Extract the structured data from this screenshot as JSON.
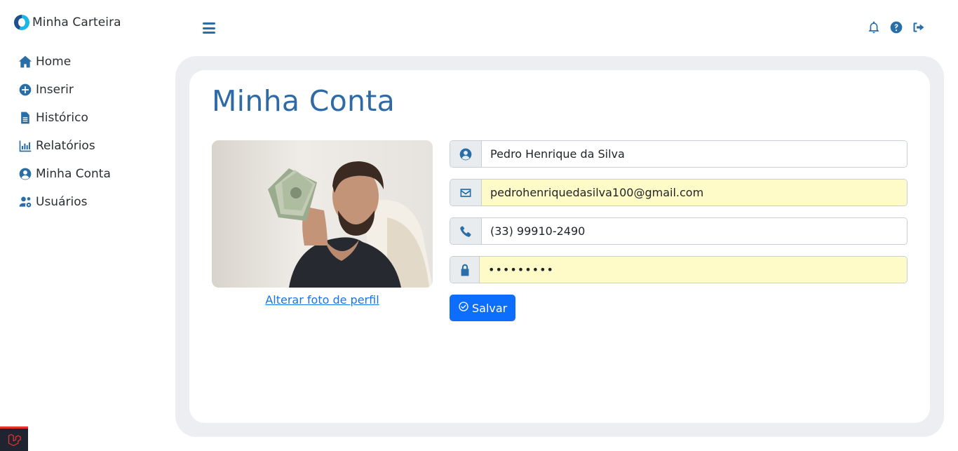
{
  "brand": {
    "name": "Minha Carteira"
  },
  "sidebar": {
    "items": [
      {
        "label": "Home",
        "icon": "home-icon"
      },
      {
        "label": "Inserir",
        "icon": "plus-circle-icon"
      },
      {
        "label": "Histórico",
        "icon": "file-icon"
      },
      {
        "label": "Relatórios",
        "icon": "bar-chart-icon"
      },
      {
        "label": "Minha Conta",
        "icon": "user-circle-icon"
      },
      {
        "label": "Usuários",
        "icon": "users-cog-icon"
      }
    ]
  },
  "topbar": {
    "menu_icon": "hamburger-icon",
    "icons": [
      "bell-icon",
      "help-icon",
      "logout-icon"
    ]
  },
  "page": {
    "title": "Minha Conta",
    "change_photo_label": "Alterar foto de perfil"
  },
  "form": {
    "name": "Pedro Henrique da Silva",
    "email": "pedrohenriquedasilva100@gmail.com",
    "phone": "(33) 99910-2490",
    "password": "•••••••••",
    "save_label": "Salvar"
  },
  "colors": {
    "accent": "#2a6ea8",
    "title": "#2f6aa7",
    "primary_button": "#0d6efd",
    "link": "#1a73e8",
    "autofill": "#fffbc8",
    "shell": "#eceef1"
  }
}
